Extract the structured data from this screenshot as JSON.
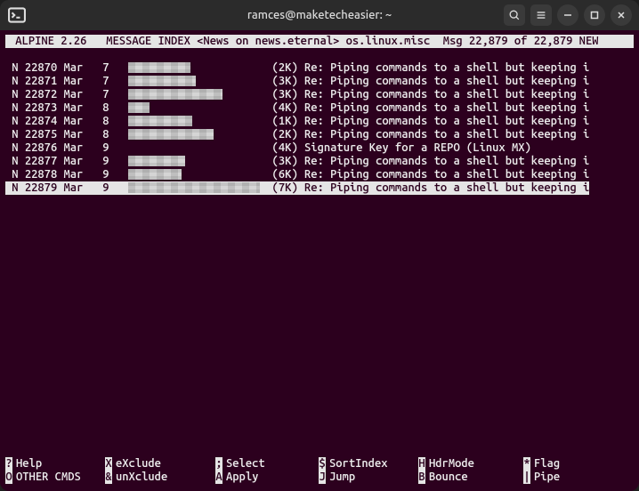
{
  "titlebar": {
    "title": "ramces@maketecheasier: ~"
  },
  "statusbar": {
    "app": "ALPINE 2.26",
    "section": "MESSAGE INDEX",
    "source": "<News on news.eternal>",
    "group": "os.linux.misc",
    "position": "Msg 22,879 of 22,879 NEW"
  },
  "messages": [
    {
      "flag": "N",
      "num": "22870",
      "month": "Mar",
      "day": "7",
      "sender_w": 70,
      "size": "(2K)",
      "subject": "Re: Piping commands to a shell but keeping i"
    },
    {
      "flag": "N",
      "num": "22871",
      "month": "Mar",
      "day": "7",
      "sender_w": 76,
      "size": "(3K)",
      "subject": "Re: Piping commands to a shell but keeping i"
    },
    {
      "flag": "N",
      "num": "22872",
      "month": "Mar",
      "day": "7",
      "sender_w": 106,
      "size": "(3K)",
      "subject": "Re: Piping commands to a shell but keeping i"
    },
    {
      "flag": "N",
      "num": "22873",
      "month": "Mar",
      "day": "8",
      "sender_w": 24,
      "size": "(4K)",
      "subject": "Re: Piping commands to a shell but keeping i"
    },
    {
      "flag": "N",
      "num": "22874",
      "month": "Mar",
      "day": "8",
      "sender_w": 72,
      "size": "(1K)",
      "subject": "Re: Piping commands to a shell but keeping i"
    },
    {
      "flag": "N",
      "num": "22875",
      "month": "Mar",
      "day": "8",
      "sender_w": 96,
      "size": "(2K)",
      "subject": "Re: Piping commands to a shell but keeping i"
    },
    {
      "flag": "N",
      "num": "22876",
      "month": "Mar",
      "day": "9",
      "sender_w": 0,
      "size": "(4K)",
      "subject": "Signature Key for a REPO (Linux MX)"
    },
    {
      "flag": "N",
      "num": "22877",
      "month": "Mar",
      "day": "9",
      "sender_w": 64,
      "size": "(3K)",
      "subject": "Re: Piping commands to a shell but keeping i"
    },
    {
      "flag": "N",
      "num": "22878",
      "month": "Mar",
      "day": "9",
      "sender_w": 60,
      "size": "(6K)",
      "subject": "Re: Piping commands to a shell but keeping i"
    },
    {
      "flag": "N",
      "num": "22879",
      "month": "Mar",
      "day": "9",
      "sender_w": 148,
      "size": "(7K)",
      "subject": "Re: Piping commands to a shell but keeping i",
      "selected": true
    }
  ],
  "commands": {
    "row1": [
      {
        "key": "?",
        "label": "Help",
        "col": 0
      },
      {
        "key": "X",
        "label": "eXclude",
        "col": 1
      },
      {
        "key": ";",
        "label": "Select",
        "col": 2
      },
      {
        "key": "$",
        "label": "SortIndex",
        "col": 3
      },
      {
        "key": "H",
        "label": "HdrMode",
        "col": 4
      },
      {
        "key": "*",
        "label": "Flag",
        "col": 5
      }
    ],
    "row2": [
      {
        "key": "O",
        "label": "OTHER CMDS",
        "col": 0
      },
      {
        "key": "&",
        "label": "unXclude",
        "col": 1
      },
      {
        "key": "A",
        "label": "Apply",
        "col": 2
      },
      {
        "key": "J",
        "label": "Jump",
        "col": 3
      },
      {
        "key": "B",
        "label": "Bounce",
        "col": 4
      },
      {
        "key": "|",
        "label": "Pipe",
        "col": 5
      }
    ]
  }
}
